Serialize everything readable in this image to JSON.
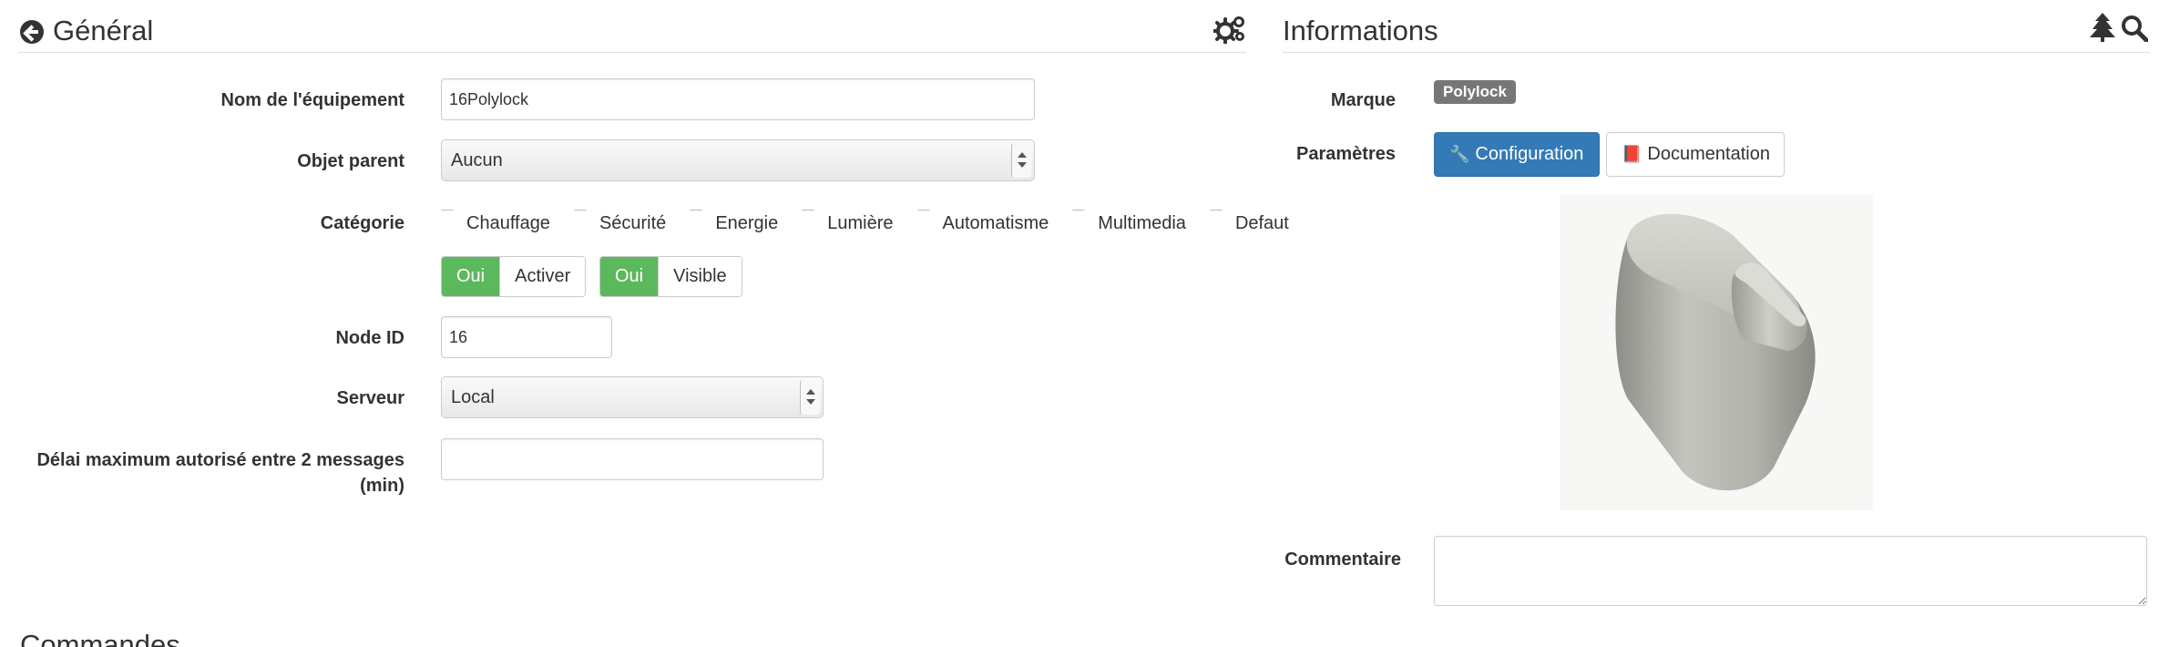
{
  "general": {
    "title": "Général",
    "fields": {
      "name_label": "Nom de l'équipement",
      "name_value": "16Polylock",
      "parent_label": "Objet parent",
      "parent_value": "Aucun",
      "category_label": "Catégorie",
      "categories": [
        "Chauffage",
        "Sécurité",
        "Energie",
        "Lumière",
        "Automatisme",
        "Multimedia",
        "Defaut"
      ],
      "toggle_enable": {
        "on": "Oui",
        "label": "Activer"
      },
      "toggle_visible": {
        "on": "Oui",
        "label": "Visible"
      },
      "node_label": "Node ID",
      "node_value": "16",
      "server_label": "Serveur",
      "server_value": "Local",
      "delay_label_line1": "Délai maximum autorisé entre 2 messages",
      "delay_label_line2": "(min)",
      "delay_value": ""
    },
    "icons": {
      "back": "arrow-circle-left-icon",
      "settings": "gears-icon"
    }
  },
  "informations": {
    "title": "Informations",
    "brand_label": "Marque",
    "brand_value": "Polylock",
    "params_label": "Paramètres",
    "config_button": "Configuration",
    "doc_button": "Documentation",
    "comment_label": "Commentaire",
    "comment_value": "",
    "icons": {
      "tree": "tree-icon",
      "search": "search-icon"
    }
  },
  "commandes": {
    "title": "Commandes"
  },
  "colors": {
    "success": "#5cb85c",
    "primary": "#337ab7",
    "badge": "#777777"
  }
}
